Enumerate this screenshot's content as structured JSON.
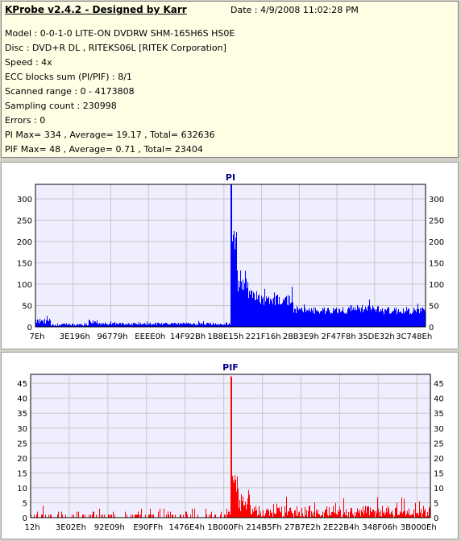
{
  "app": {
    "title": "KProbe v2.4.2 - Designed by Karr",
    "date": "Date : 4/9/2008 11:02:28 PM"
  },
  "info": {
    "lines": [
      "Model : 0-0-1-0 LITE-ON DVDRW SHM-165H6S HS0E",
      "Disc : DVD+R DL , RITEKS06L [RITEK Corporation]",
      "Speed : 4x",
      "ECC blocks sum (PI/PIF) : 8/1",
      "Scanned range : 0 - 4173808",
      "Sampling count : 230998",
      "Errors : 0",
      "PI Max= 334 , Average= 19.17 , Total= 632636",
      "PIF Max= 48 , Average= 0.71 , Total= 23404"
    ]
  },
  "colors": {
    "pi": "#0000ff",
    "pif": "#ff0000",
    "plot_bg": "#eeeeff",
    "grid": "#c8c8c8"
  },
  "chart_data": [
    {
      "type": "bar",
      "title": "PI",
      "title_color": "#00008b",
      "ylim": [
        0,
        334
      ],
      "yticks": [
        0,
        50,
        100,
        150,
        200,
        250,
        300
      ],
      "xticks": [
        "7Eh",
        "3E196h",
        "96779h",
        "EEEE0h",
        "14F92Bh",
        "1B8E15h",
        "221F16h",
        "28B3E9h",
        "2F47F8h",
        "35DE32h",
        "3C748Eh"
      ],
      "grid": true,
      "series": [
        {
          "color": "#0000ff",
          "segments": [
            {
              "x": [
                0.0,
                0.0375
              ],
              "level": 13,
              "var": 6
            },
            {
              "x": [
                0.0375,
                0.1375
              ],
              "level": 5,
              "var": 3
            },
            {
              "x": [
                0.1375,
                0.158
              ],
              "level": 12,
              "var": 5
            },
            {
              "x": [
                0.158,
                0.5
              ],
              "level": 7,
              "var": 3
            },
            {
              "x": [
                0.5,
                0.503
              ],
              "level": 334,
              "var": 20
            },
            {
              "x": [
                0.503,
                0.515
              ],
              "level": 190,
              "var": 40
            },
            {
              "x": [
                0.515,
                0.545
              ],
              "level": 110,
              "var": 30
            },
            {
              "x": [
                0.545,
                0.58
              ],
              "level": 70,
              "var": 18
            },
            {
              "x": [
                0.58,
                0.66
              ],
              "level": 62,
              "var": 15
            },
            {
              "x": [
                0.66,
                0.8
              ],
              "level": 38,
              "var": 8
            },
            {
              "x": [
                0.8,
                0.88
              ],
              "level": 42,
              "var": 10
            },
            {
              "x": [
                0.88,
                1.0
              ],
              "level": 38,
              "var": 9
            }
          ]
        }
      ]
    },
    {
      "type": "bar",
      "title": "PIF",
      "title_color": "#00008b",
      "ylim": [
        0,
        48
      ],
      "yticks": [
        0,
        5,
        10,
        15,
        20,
        25,
        30,
        35,
        40,
        45
      ],
      "xticks": [
        "12h",
        "3E02Eh",
        "92E09h",
        "E90FFh",
        "1476E4h",
        "1B000Fh",
        "214B5Fh",
        "27B7E2h",
        "2E22B4h",
        "348F06h",
        "3B000Eh"
      ],
      "grid": true,
      "series": [
        {
          "color": "#ff0000",
          "segments": [
            {
              "x": [
                0.0,
                0.0375
              ],
              "level": 2,
              "var": 2,
              "sparse": true
            },
            {
              "x": [
                0.0375,
                0.5
              ],
              "level": 1,
              "var": 1,
              "sparse": true
            },
            {
              "x": [
                0.5,
                0.503
              ],
              "level": 48,
              "var": 1
            },
            {
              "x": [
                0.503,
                0.52
              ],
              "level": 11,
              "var": 3
            },
            {
              "x": [
                0.52,
                0.55
              ],
              "level": 5,
              "var": 3
            },
            {
              "x": [
                0.55,
                1.0
              ],
              "level": 2,
              "var": 2
            }
          ]
        }
      ]
    }
  ]
}
